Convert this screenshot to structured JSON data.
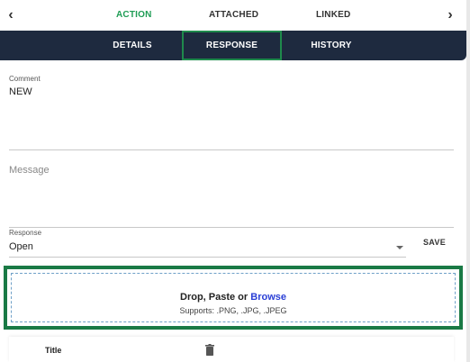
{
  "top_tabs": {
    "items": [
      {
        "label": "ACTION",
        "active": true
      },
      {
        "label": "ATTACHED",
        "active": false
      },
      {
        "label": "LINKED",
        "active": false
      }
    ],
    "prev_icon": "chevron-left-icon",
    "next_icon": "chevron-right-icon",
    "active_color": "#1f9d55"
  },
  "sub_tabs": {
    "items": [
      {
        "label": "DETAILS",
        "active": false
      },
      {
        "label": "RESPONSE",
        "active": true
      },
      {
        "label": "HISTORY",
        "active": false
      }
    ],
    "bar_color": "#1e2a3f",
    "active_border_color": "#1f8a4c"
  },
  "form": {
    "comment_label": "Comment",
    "comment_value": "NEW",
    "message_placeholder": "Message",
    "response_label": "Response",
    "response_value": "Open",
    "save_label": "SAVE"
  },
  "dropzone": {
    "title_prefix": "Drop, Paste or ",
    "browse_label": "Browse",
    "supports": "Supports: .PNG, .JPG, .JPEG",
    "highlight_color": "#1a7a45"
  },
  "list": {
    "title_header": "Title",
    "delete_icon": "trash-icon"
  }
}
